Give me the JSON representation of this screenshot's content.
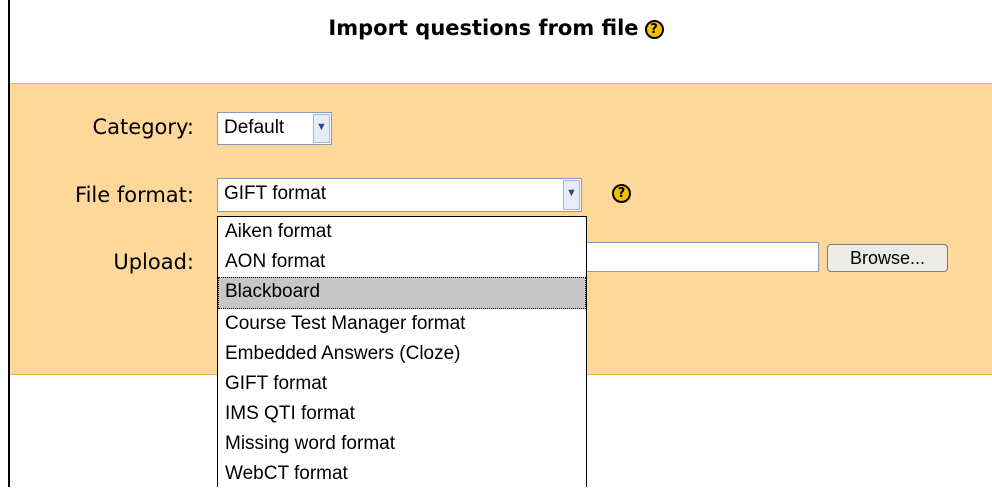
{
  "header": {
    "title": "Import questions from file",
    "help_icon": "?"
  },
  "form": {
    "category_label": "Category:",
    "category_value": "Default",
    "file_format_label": "File format:",
    "file_format_value": "GIFT format",
    "file_format_help": "?",
    "upload_label": "Upload:",
    "browse_label": "Browse..."
  },
  "dropdown": {
    "options": [
      "Aiken format",
      "AON format",
      "Blackboard",
      "Course Test Manager format",
      "Embedded Answers (Cloze)",
      "GIFT format",
      "IMS QTI format",
      "Missing word format",
      "WebCT format"
    ],
    "highlighted": "Blackboard"
  },
  "colors": {
    "panel_bg": "#fdd89a",
    "help_icon": "#f2c200",
    "highlight": "#c7c7c7"
  },
  "icons": {
    "help": "help-icon",
    "dropdown_arrow": "chevron-down-icon"
  }
}
